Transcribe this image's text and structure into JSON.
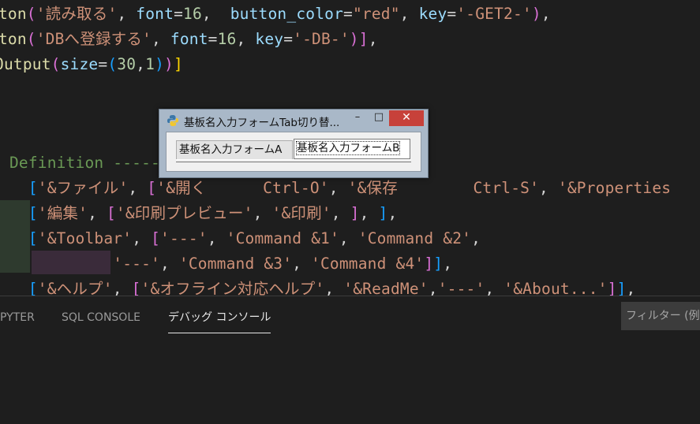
{
  "editor": {
    "lines": [
      [
        [
          "tk-fn",
          "tton"
        ],
        [
          "tk-p2",
          "("
        ],
        [
          "tk-str",
          "'読み取る'"
        ],
        [
          "tk-op",
          ", "
        ],
        [
          "tk-kw",
          "font"
        ],
        [
          "tk-op",
          "="
        ],
        [
          "tk-num",
          "16"
        ],
        [
          "tk-op",
          ",  "
        ],
        [
          "tk-kw",
          "button_color"
        ],
        [
          "tk-op",
          "="
        ],
        [
          "tk-str",
          "\"red\""
        ],
        [
          "tk-op",
          ", "
        ],
        [
          "tk-kw",
          "key"
        ],
        [
          "tk-op",
          "="
        ],
        [
          "tk-str",
          "'-GET2-'"
        ],
        [
          "tk-p2",
          ")"
        ],
        [
          "tk-op",
          ","
        ]
      ],
      [
        [
          "tk-fn",
          "tton"
        ],
        [
          "tk-p2",
          "("
        ],
        [
          "tk-str",
          "'DBへ登録する'"
        ],
        [
          "tk-op",
          ", "
        ],
        [
          "tk-kw",
          "font"
        ],
        [
          "tk-op",
          "="
        ],
        [
          "tk-num",
          "16"
        ],
        [
          "tk-op",
          ", "
        ],
        [
          "tk-kw",
          "key"
        ],
        [
          "tk-op",
          "="
        ],
        [
          "tk-str",
          "'-DB-'"
        ],
        [
          "tk-p2",
          ")"
        ],
        [
          "tk-p2",
          "]"
        ],
        [
          "tk-op",
          ","
        ]
      ],
      [
        [
          "tk-fn",
          "Output"
        ],
        [
          "tk-p2",
          "("
        ],
        [
          "tk-kw",
          "size"
        ],
        [
          "tk-op",
          "="
        ],
        [
          "tk-p3",
          "("
        ],
        [
          "tk-num",
          "30"
        ],
        [
          "tk-op",
          ","
        ],
        [
          "tk-num",
          "1"
        ],
        [
          "tk-p3",
          ")"
        ],
        [
          "tk-p2",
          ")"
        ],
        [
          "tk-p1",
          "]"
        ]
      ],
      [],
      [],
      [
        [
          "tk-op",
          " "
        ],
        [
          "tk-cm",
          "Definition -----"
        ]
      ],
      [
        [
          "tk-op",
          "   "
        ],
        [
          "tk-p3",
          "["
        ],
        [
          "tk-str",
          "'&ファイル'"
        ],
        [
          "tk-op",
          ", "
        ],
        [
          "tk-p2",
          "["
        ],
        [
          "tk-str",
          "'&開く      Ctrl-O'"
        ],
        [
          "tk-op",
          ", "
        ],
        [
          "tk-str",
          "'&保存        Ctrl-S'"
        ],
        [
          "tk-op",
          ", "
        ],
        [
          "tk-str",
          "'&Properties"
        ]
      ],
      [
        [
          "tk-op",
          "   "
        ],
        [
          "tk-p3",
          "["
        ],
        [
          "tk-str",
          "'編集'"
        ],
        [
          "tk-op",
          ", "
        ],
        [
          "tk-p2",
          "["
        ],
        [
          "tk-str",
          "'&印刷プレビュー'"
        ],
        [
          "tk-op",
          ", "
        ],
        [
          "tk-str",
          "'&印刷'"
        ],
        [
          "tk-op",
          ", "
        ],
        [
          "tk-p2",
          "]"
        ],
        [
          "tk-op",
          ", "
        ],
        [
          "tk-p3",
          "]"
        ],
        [
          "tk-op",
          ","
        ]
      ],
      [
        [
          "tk-op",
          "   "
        ],
        [
          "tk-p3",
          "["
        ],
        [
          "tk-str",
          "'&Toolbar'"
        ],
        [
          "tk-op",
          ", "
        ],
        [
          "tk-p2",
          "["
        ],
        [
          "tk-str",
          "'---'"
        ],
        [
          "tk-op",
          ", "
        ],
        [
          "tk-str",
          "'Command &1'"
        ],
        [
          "tk-op",
          ", "
        ],
        [
          "tk-str",
          "'Command &2'"
        ],
        [
          "tk-op",
          ","
        ]
      ],
      [
        [
          "tk-op",
          "            "
        ],
        [
          "tk-str",
          "'---'"
        ],
        [
          "tk-op",
          ", "
        ],
        [
          "tk-str",
          "'Command &3'"
        ],
        [
          "tk-op",
          ", "
        ],
        [
          "tk-str",
          "'Command &4'"
        ],
        [
          "tk-p2",
          "]"
        ],
        [
          "tk-p3",
          "]"
        ],
        [
          "tk-op",
          ","
        ]
      ],
      [
        [
          "tk-op",
          "   "
        ],
        [
          "tk-p3",
          "["
        ],
        [
          "tk-str",
          "'&ヘルプ'"
        ],
        [
          "tk-op",
          ", "
        ],
        [
          "tk-p2",
          "["
        ],
        [
          "tk-str",
          "'&オフライン対応ヘルプ'"
        ],
        [
          "tk-op",
          ", "
        ],
        [
          "tk-str",
          "'&ReadMe'"
        ],
        [
          "tk-op",
          ","
        ],
        [
          "tk-str",
          "'---'"
        ],
        [
          "tk-op",
          ", "
        ],
        [
          "tk-str",
          "'&About...'"
        ],
        [
          "tk-p2",
          "]"
        ],
        [
          "tk-p3",
          "]"
        ],
        [
          "tk-op",
          ","
        ]
      ]
    ]
  },
  "window": {
    "title": "基板名入力フォームTab切り替...",
    "minimize": "–",
    "maximize": "□",
    "close": "✕",
    "tabs": [
      "基板名入力フォームA",
      "基板名入力フォームB"
    ]
  },
  "panel": {
    "tabs": [
      "PYTER",
      "SQL CONSOLE",
      "デバッグ コンソール"
    ],
    "active_tab": "デバッグ コンソール",
    "filter_placeholder": "フィルター (例:"
  }
}
